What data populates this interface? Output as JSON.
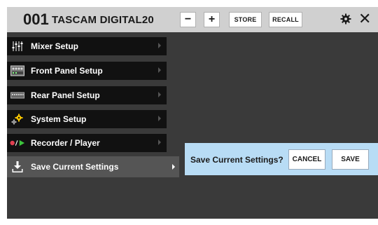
{
  "header": {
    "preset_number": "001",
    "preset_name": "TASCAM DIGITAL20",
    "minus_label": "−",
    "plus_label": "+",
    "store_label": "STORE",
    "recall_label": "RECALL",
    "settings_icon": "gear-icon",
    "close_label": "✕"
  },
  "menu": {
    "items": [
      {
        "label": "Mixer Setup",
        "icon": "mixer-faders-icon"
      },
      {
        "label": "Front Panel Setup",
        "icon": "front-panel-icon"
      },
      {
        "label": "Rear Panel Setup",
        "icon": "rear-panel-icon"
      },
      {
        "label": "System Setup",
        "icon": "system-gears-icon"
      },
      {
        "label": "Recorder / Player",
        "icon": "record-play-icon"
      },
      {
        "label": "Save Current Settings",
        "icon": "download-save-icon",
        "selected": true
      }
    ]
  },
  "dialog": {
    "question": "Save Current Settings?",
    "cancel_label": "CANCEL",
    "save_label": "SAVE"
  },
  "colors": {
    "topbar": "#d0d0d0",
    "panel": "#3a3a3a",
    "menu_item": "#111111",
    "menu_selected": "#555555",
    "dialog": "#b8dcf5",
    "record_red": "#e04050",
    "play_green": "#3cc43c"
  }
}
